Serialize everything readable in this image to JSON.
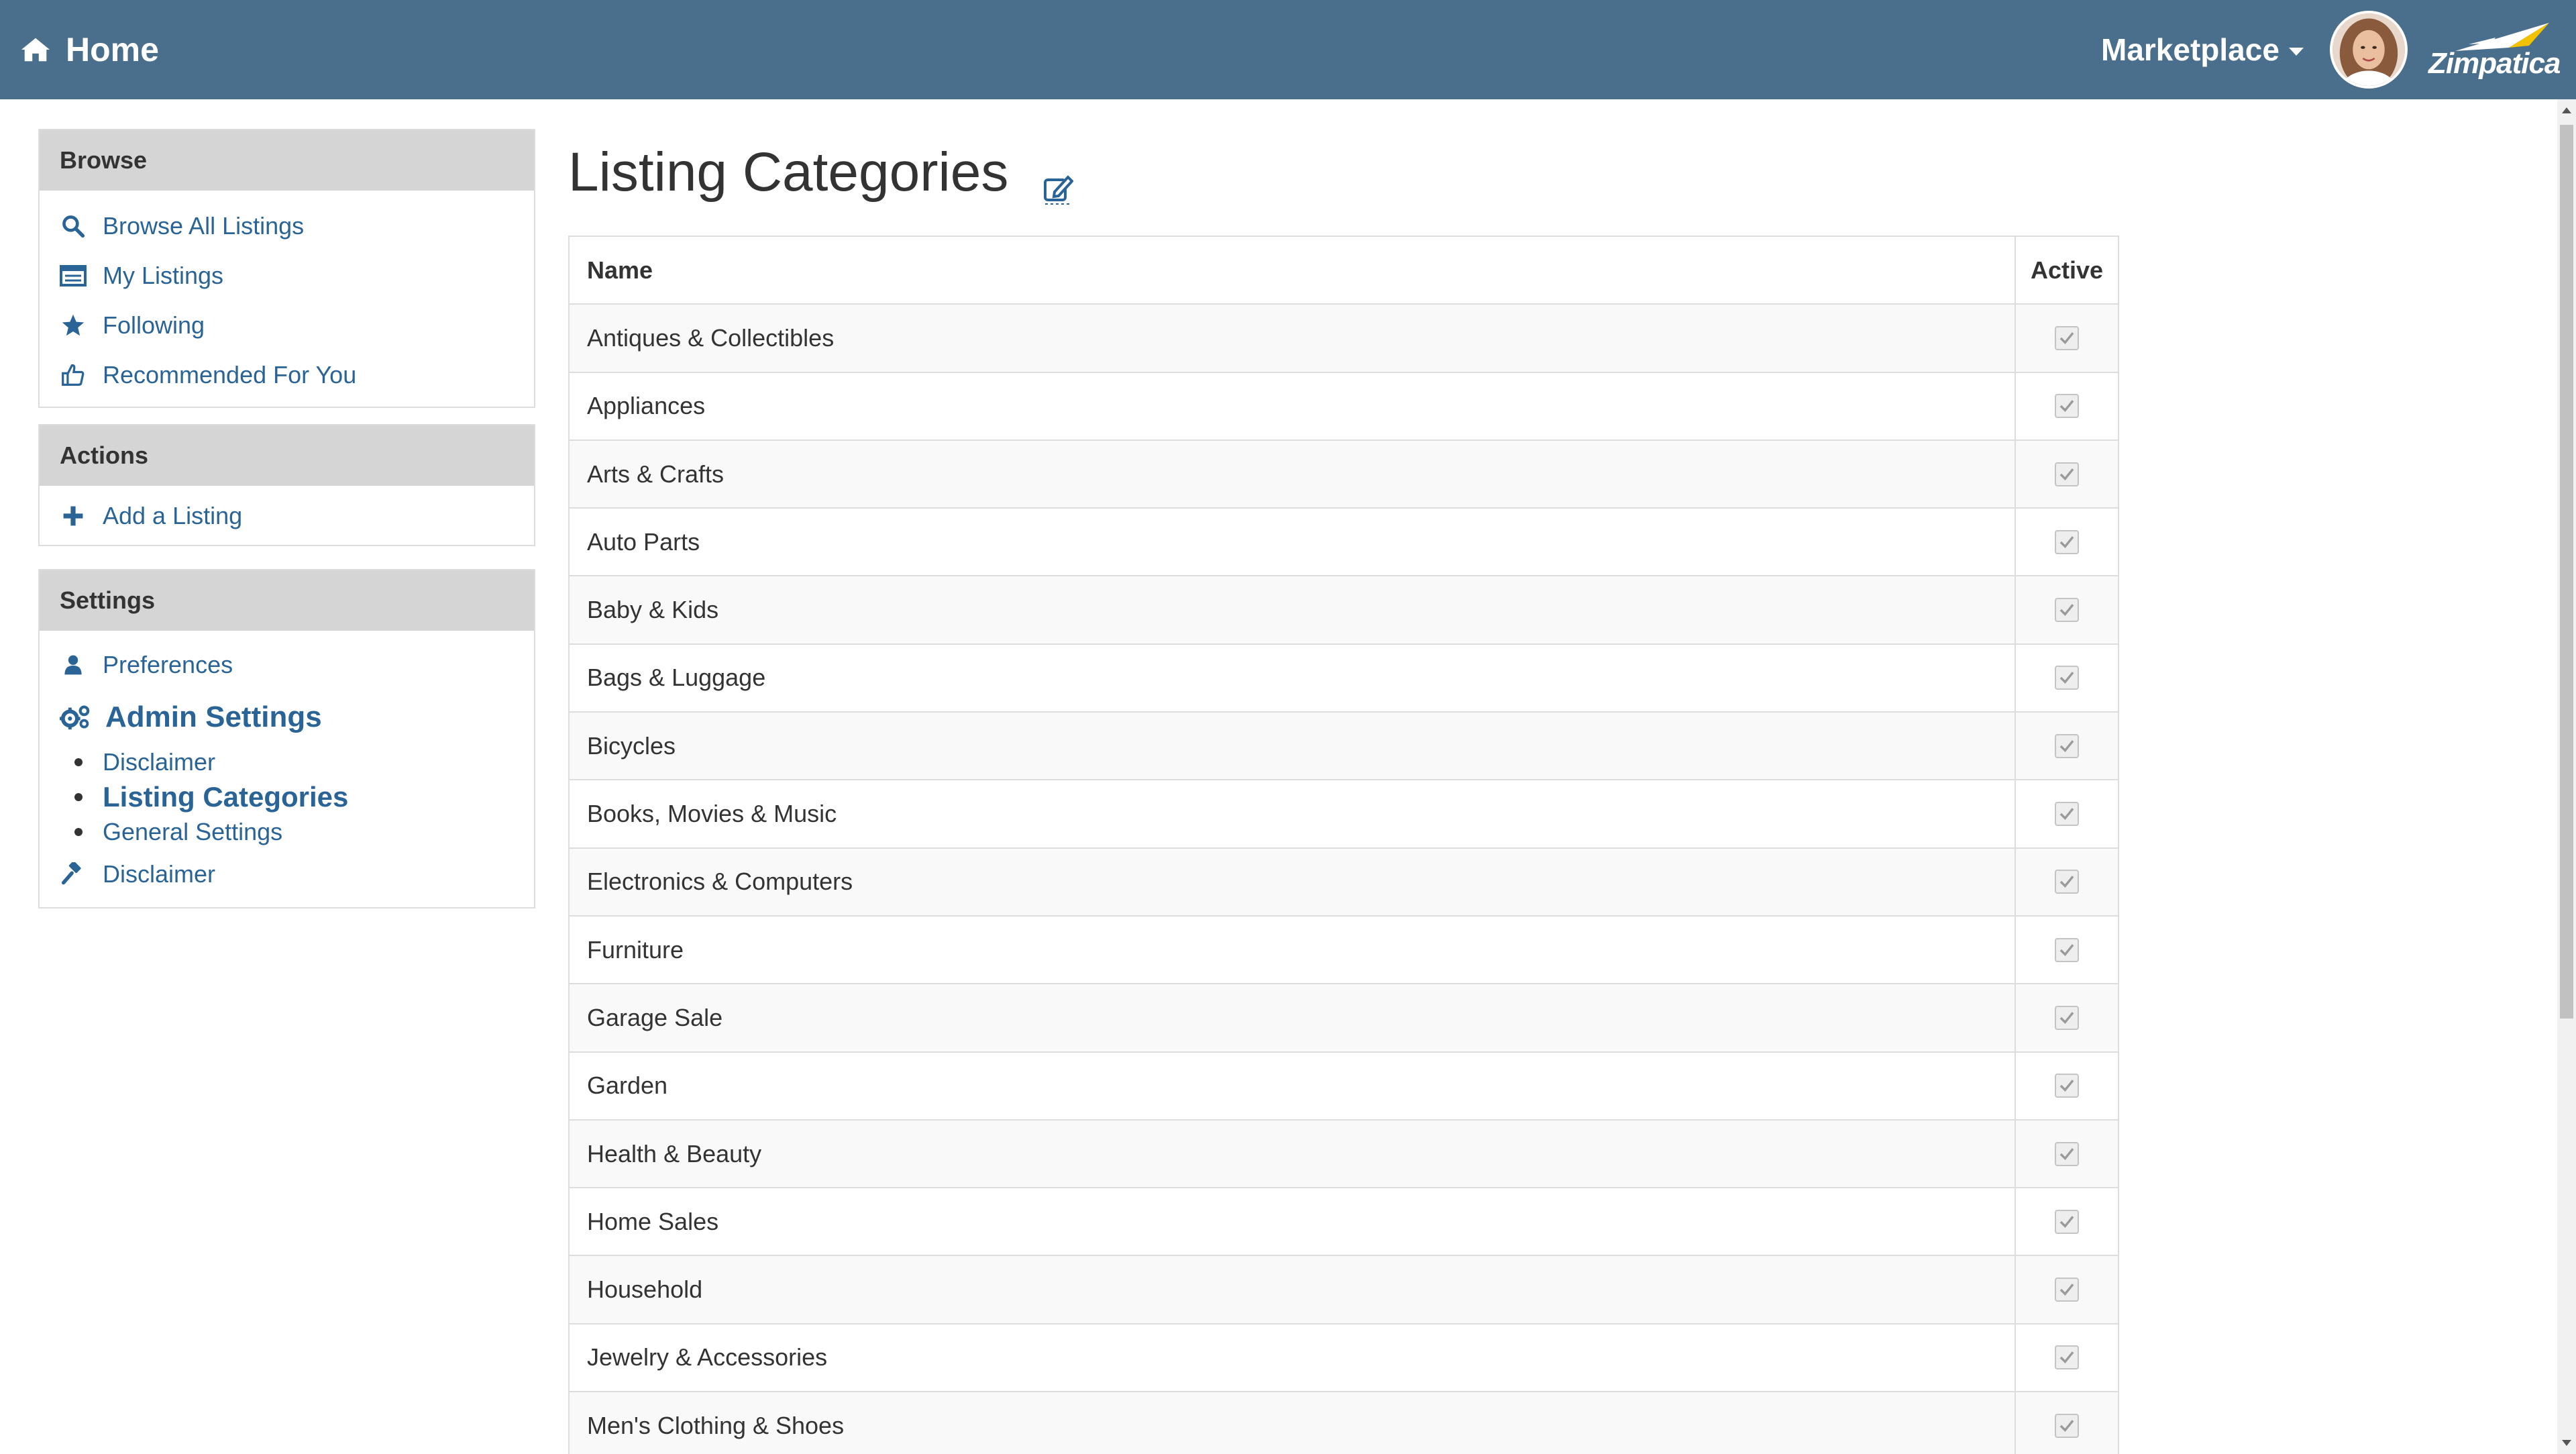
{
  "navbar": {
    "home_label": "Home",
    "marketplace_label": "Marketplace",
    "logo_text": "Zimpatica",
    "background_color": "#4a6f8c"
  },
  "sidebar": {
    "browse": {
      "title": "Browse",
      "items": [
        {
          "label": "Browse All Listings",
          "icon": "search-icon"
        },
        {
          "label": "My Listings",
          "icon": "list-icon"
        },
        {
          "label": "Following",
          "icon": "star-icon"
        },
        {
          "label": "Recommended For You",
          "icon": "thumbs-up-icon"
        }
      ]
    },
    "actions": {
      "title": "Actions",
      "items": [
        {
          "label": "Add a Listing",
          "icon": "plus-icon"
        }
      ]
    },
    "settings": {
      "title": "Settings",
      "preferences_label": "Preferences",
      "admin_label": "Admin Settings",
      "admin_sub": [
        {
          "label": "Disclaimer"
        },
        {
          "label": "Listing Categories"
        },
        {
          "label": "General Settings"
        }
      ],
      "disclaimer_label": "Disclaimer"
    }
  },
  "main": {
    "title": "Listing Categories",
    "table": {
      "headers": {
        "name": "Name",
        "active": "Active"
      },
      "rows": [
        {
          "name": "Antiques & Collectibles",
          "active": true
        },
        {
          "name": "Appliances",
          "active": true
        },
        {
          "name": "Arts & Crafts",
          "active": true
        },
        {
          "name": "Auto Parts",
          "active": true
        },
        {
          "name": "Baby & Kids",
          "active": true
        },
        {
          "name": "Bags & Luggage",
          "active": true
        },
        {
          "name": "Bicycles",
          "active": true
        },
        {
          "name": "Books, Movies & Music",
          "active": true
        },
        {
          "name": "Electronics & Computers",
          "active": true
        },
        {
          "name": "Furniture",
          "active": true
        },
        {
          "name": "Garage Sale",
          "active": true
        },
        {
          "name": "Garden",
          "active": true
        },
        {
          "name": "Health & Beauty",
          "active": true
        },
        {
          "name": "Home Sales",
          "active": true
        },
        {
          "name": "Household",
          "active": true
        },
        {
          "name": "Jewelry & Accessories",
          "active": true
        },
        {
          "name": "Men's Clothing & Shoes",
          "active": true
        }
      ]
    }
  },
  "colors": {
    "link": "#2a6496",
    "panel_header": "#d5d5d5"
  }
}
